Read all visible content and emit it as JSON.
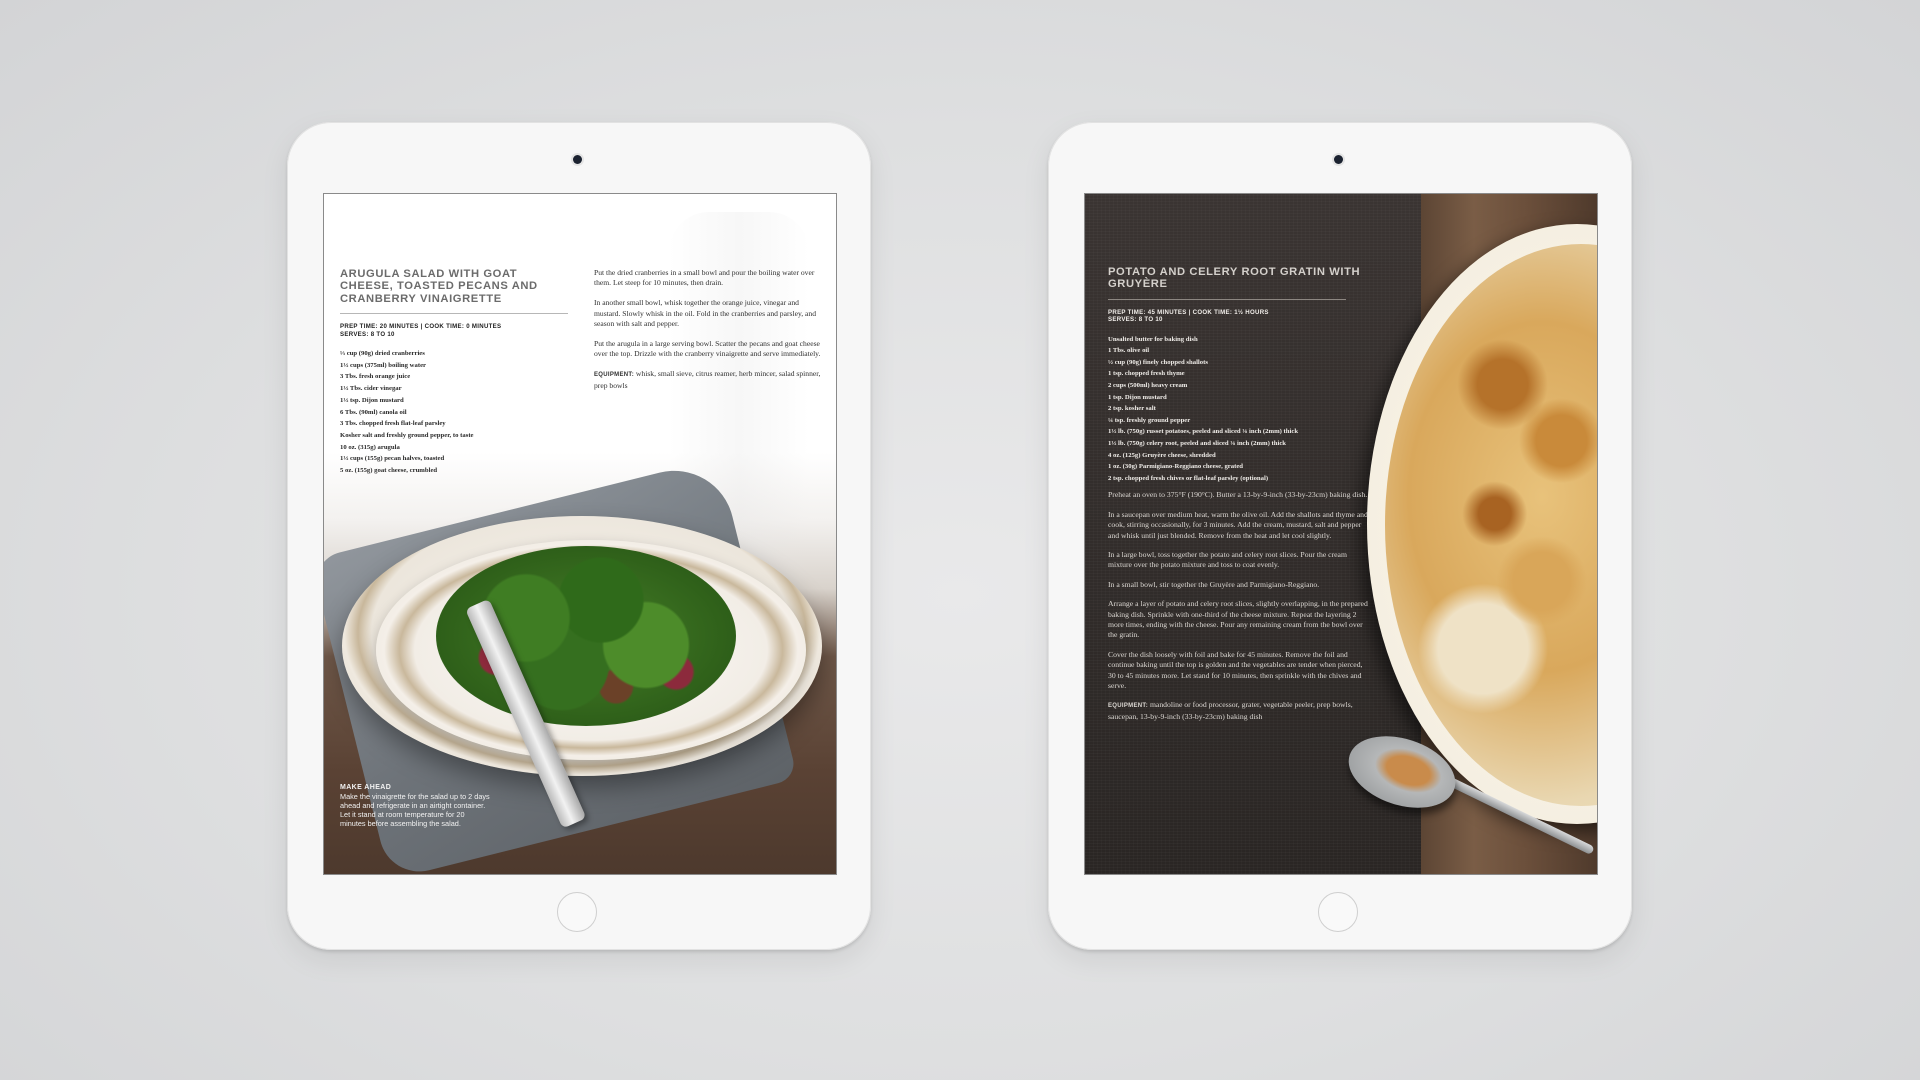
{
  "left_page": {
    "title": "ARUGULA SALAD WITH GOAT CHEESE, TOASTED PECANS AND CRANBERRY VINAIGRETTE",
    "prep_line": "PREP TIME: 20 MINUTES  |  COOK TIME: 0 MINUTES",
    "serves": "SERVES: 8 TO 10",
    "ingredients": [
      "⅓ cup (90g) dried cranberries",
      "1½ cups (375ml) boiling water",
      "3 Tbs. fresh orange juice",
      "1½ Tbs. cider vinegar",
      "1½ tsp. Dijon mustard",
      "6 Tbs. (90ml) canola oil",
      "3 Tbs. chopped fresh flat-leaf parsley",
      "Kosher salt and freshly ground pepper, to taste",
      "10 oz. (315g) arugula",
      "1½ cups (155g) pecan halves, toasted",
      "5 oz. (155g) goat cheese, crumbled"
    ],
    "steps": [
      "Put the dried cranberries in a small bowl and pour the boiling water over them. Let steep for 10 minutes, then drain.",
      "In another small bowl, whisk together the orange juice, vinegar and mustard. Slowly whisk in the oil. Fold in the cranberries and parsley, and season with salt and pepper.",
      "Put the arugula in a large serving bowl. Scatter the pecans and goat cheese over the top. Drizzle with the cranberry vinaigrette and serve immediately."
    ],
    "equipment_label": "EQUIPMENT:",
    "equipment_text": "whisk, small sieve, citrus reamer, herb mincer, salad spinner, prep bowls",
    "make_ahead_title": "MAKE AHEAD",
    "make_ahead_text": "Make the vinaigrette for the salad up to 2 days ahead and refrigerate in an airtight container. Let it stand at room temperature for 20 minutes before assembling the salad."
  },
  "right_page": {
    "title": "POTATO AND CELERY ROOT GRATIN WITH GRUYÈRE",
    "prep_line": "PREP TIME: 45 MINUTES  |  COOK TIME: 1½ HOURS",
    "serves": "SERVES: 8 TO 10",
    "ingredients": [
      "Unsalted butter for baking dish",
      "1 Tbs. olive oil",
      "½ cup (90g) finely chopped shallots",
      "1 tsp. chopped fresh thyme",
      "2 cups (500ml) heavy cream",
      "1 tsp. Dijon mustard",
      "2 tsp. kosher salt",
      "¼ tsp. freshly ground pepper",
      "1½ lb. (750g) russet potatoes, peeled and sliced ⅛ inch (2mm) thick",
      "1½ lb. (750g) celery root, peeled and sliced ⅛ inch (2mm) thick",
      "4 oz. (125g) Gruyère cheese, shredded",
      "1 oz. (30g) Parmigiano-Reggiano cheese, grated",
      "2 tsp. chopped fresh chives or flat-leaf parsley (optional)"
    ],
    "steps": [
      "Preheat an oven to 375°F (190°C). Butter a 13-by-9-inch (33-by-23cm) baking dish.",
      "In a saucepan over medium heat, warm the olive oil. Add the shallots and thyme and cook, stirring occasionally, for 3 minutes. Add the cream, mustard, salt and pepper and whisk until just blended. Remove from the heat and let cool slightly.",
      "In a large bowl, toss together the potato and celery root slices. Pour the cream mixture over the potato mixture and toss to coat evenly.",
      "In a small bowl, stir together the Gruyère and Parmigiano-Reggiano.",
      "Arrange a layer of potato and celery root slices, slightly overlapping, in the prepared baking dish. Sprinkle with one-third of the cheese mixture. Repeat the layering 2 more times, ending with the cheese. Pour any remaining cream from the bowl over the gratin.",
      "Cover the dish loosely with foil and bake for 45 minutes. Remove the foil and continue baking until the top is golden and the vegetables are tender when pierced, 30 to 45 minutes more. Let stand for 10 minutes, then sprinkle with the chives and serve."
    ],
    "equipment_label": "EQUIPMENT:",
    "equipment_text": "mandoline or food processor, grater, vegetable peeler, prep bowls, saucepan, 13-by-9-inch (33-by-23cm) baking dish"
  },
  "colors": {
    "background": "#dedfe0",
    "tablet_body": "#f7f7f7",
    "left_title": "#6b6b6b",
    "right_page_bg": "#2f2b2a"
  }
}
